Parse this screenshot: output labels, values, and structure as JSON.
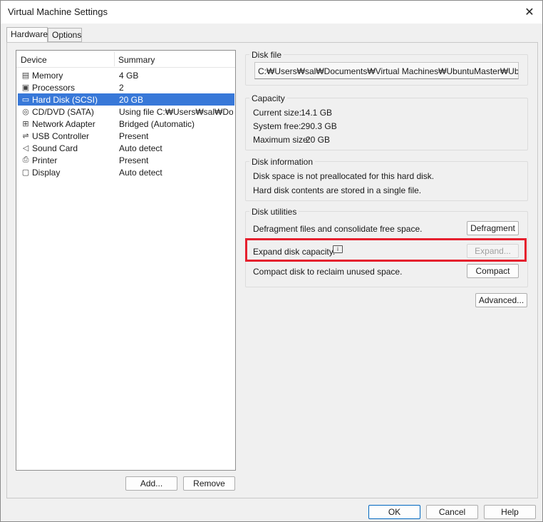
{
  "window": {
    "title": "Virtual Machine Settings",
    "close_icon": "close-icon"
  },
  "tabs": [
    {
      "label": "Hardware",
      "active": true
    },
    {
      "label": "Options",
      "active": false
    }
  ],
  "device_list": {
    "headers": {
      "device": "Device",
      "summary": "Summary"
    },
    "rows": [
      {
        "device": "Memory",
        "summary": "4 GB",
        "icon": "memory-icon"
      },
      {
        "device": "Processors",
        "summary": "2",
        "icon": "processor-icon"
      },
      {
        "device": "Hard Disk (SCSI)",
        "summary": "20 GB",
        "icon": "hard-disk-icon",
        "selected": true
      },
      {
        "device": "CD/DVD (SATA)",
        "summary": "Using file C:₩Users₩sal₩Do...",
        "icon": "cd-dvd-icon"
      },
      {
        "device": "Network Adapter",
        "summary": "Bridged (Automatic)",
        "icon": "network-icon"
      },
      {
        "device": "USB Controller",
        "summary": "Present",
        "icon": "usb-icon"
      },
      {
        "device": "Sound Card",
        "summary": "Auto detect",
        "icon": "speaker-icon"
      },
      {
        "device": "Printer",
        "summary": "Present",
        "icon": "printer-icon"
      },
      {
        "device": "Display",
        "summary": "Auto detect",
        "icon": "display-icon"
      }
    ],
    "add_label": "Add...",
    "remove_label": "Remove"
  },
  "disk_file": {
    "label": "Disk file",
    "path": "C:₩Users₩sal₩Documents₩Virtual Machines₩UbuntuMaster₩UbuntuMaster.vmdk"
  },
  "capacity": {
    "label": "Capacity",
    "current_label": "Current size:",
    "current_value": "14.1 GB",
    "free_label": "System free:",
    "free_value": "290.3 GB",
    "max_label": "Maximum size:",
    "max_value": "20 GB"
  },
  "disk_information": {
    "label": "Disk information",
    "line1": "Disk space is not preallocated for this hard disk.",
    "line2": "Hard disk contents are stored in a single file."
  },
  "disk_utilities": {
    "label": "Disk utilities",
    "defrag_text": "Defragment files and consolidate free space.",
    "defrag_button": "Defragment",
    "expand_text": "Expand disk capacity.",
    "expand_button": "Expand...",
    "compact_text": "Compact disk to reclaim unused space.",
    "compact_button": "Compact"
  },
  "advanced_button": "Advanced...",
  "footer": {
    "ok": "OK",
    "cancel": "Cancel",
    "help": "Help"
  },
  "colors": {
    "selection": "#3878d8",
    "highlight_box": "#e5202e"
  }
}
